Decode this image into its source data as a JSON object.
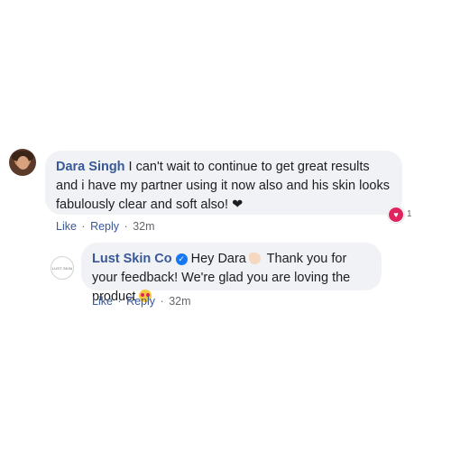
{
  "comment": {
    "author": "Dara Singh",
    "text": "I can't wait to continue to get great results and i have my partner using it now also and his skin looks fabulously clear and soft also!",
    "trailing_icon": "black-heart",
    "reaction_icon": "love-reaction",
    "reaction_count": "1",
    "actions": {
      "like": "Like",
      "reply": "Reply",
      "separator": "·",
      "time": "32m"
    }
  },
  "reply": {
    "author": "Lust Skin Co",
    "avatar_text": "LUST SKIN",
    "verified_icon": "verified-badge",
    "text_part1": "Hey Dara",
    "text_part2": "Thank you for your feedback! We're glad you are loving the product",
    "emoji_1": "waving-hand",
    "emoji_2": "heart-eyes",
    "actions": {
      "like": "Like",
      "reply": "Reply",
      "separator": "·",
      "time": "32m"
    }
  },
  "colors": {
    "author": "#385898",
    "bubble": "#f0f2f5",
    "meta": "#65676b",
    "verified": "#1877f2",
    "love": "#e0245e"
  }
}
